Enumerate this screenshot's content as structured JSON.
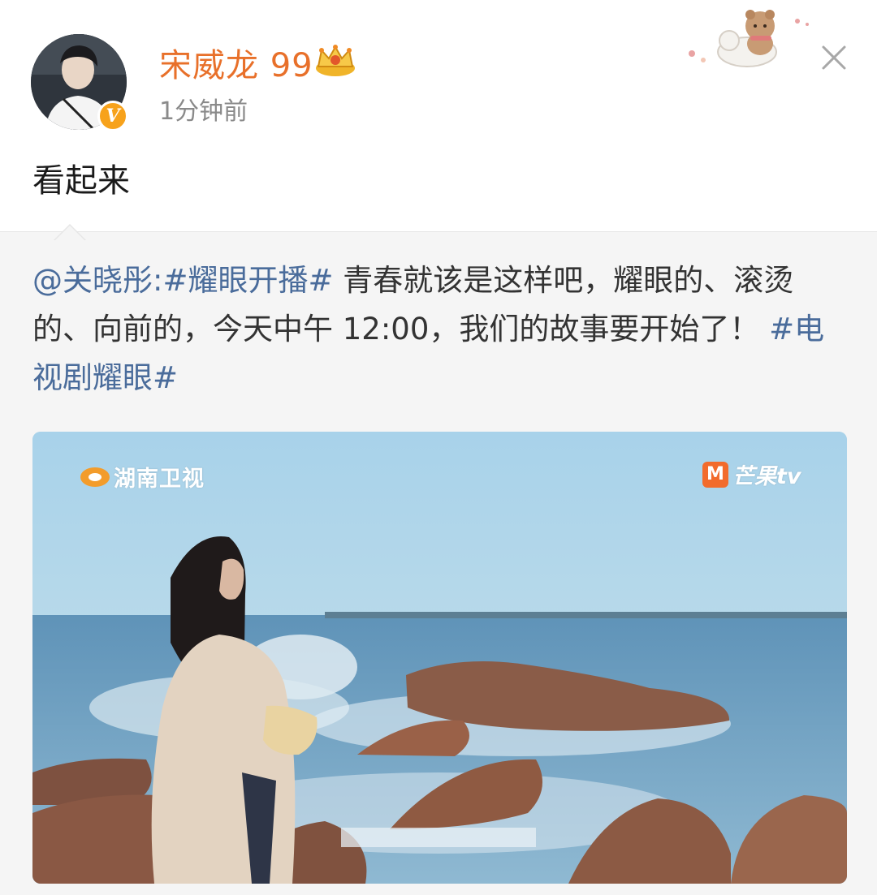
{
  "post": {
    "username": "宋威龙 99",
    "time": "1分钟前",
    "text": "看起来"
  },
  "repost": {
    "mention": "@关晓彤",
    "colon": ":",
    "hashtag1": "#耀眼开播#",
    "body": " 青春就该是这样吧，耀眼的、滚烫的、向前的，今天中午 12:00，我们的故事要开始了！",
    "hashtag2": "#电视剧耀眼#"
  },
  "media": {
    "logo_left": "湖南卫视",
    "logo_right_mark": "M",
    "logo_right": "芒果tv"
  },
  "colors": {
    "username": "#e8702a",
    "link": "#4a6c9b",
    "repost_bg": "#f5f5f5"
  },
  "icons": [
    "avatar",
    "verified-badge-icon",
    "crown-icon",
    "close-icon",
    "sticker-decoration"
  ]
}
